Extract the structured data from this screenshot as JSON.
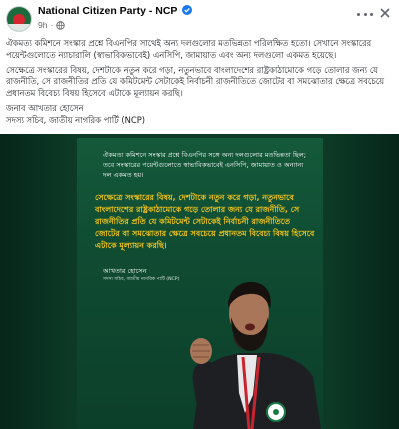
{
  "post": {
    "page_name": "National Citizen Party - NCP",
    "verified": true,
    "time": "9h",
    "separator": "·",
    "paragraphs": [
      "ঐকমত্য কমিশনে সংস্কার প্রশ্নে বিএনপির সাথেই অন্য দলগুলোর মতভিন্নতা পরিলক্ষিত হতো। সেখানে সংস্কারের পয়েন্টগুলোতে ন্যাচারালি (স্বাভাবিকভাবেই) এনসিপি, জামায়াত এবং অন্য দলগুলো একমত হয়েছে।",
      "সেক্ষেত্রে সংস্কারের বিষয়, দেশটাকে নতুন করে গড়া, নতুনভাবে বাংলাদেশের রাষ্ট্রকাঠামোকে গড়ে তোলার জন্য যে রাজনীতি, সে রাজনীতির প্রতি যে কমিটমেন্ট সেটাকেই নির্বাচনী রাজনীতিতে জোটের বা সমঝোতার ক্ষেত্রে সবচেয়ে প্রধানতম বিবেচ্য বিষয় হিসেবে এটাকে মূল্যায়ন করছি।"
    ],
    "author_name": "জনাব আখতার হোসেন",
    "author_role": "সদস্য সচিব, জাতীয় নাগরিক পার্টি (NCP)"
  },
  "poster": {
    "top_text": "ঐকমত্য কমিশনে সংস্কার প্রশ্নে বিএনপির সঙ্গে অন্য দলগুলোর মতভিন্নতা ছিল; তবে সংস্কারের পয়েন্টগুলোতে স্বাভাবিকভাবেই এনসিপি, জামায়াত ও অন্যান্য দল একমত হয়।",
    "highlight_text": "সেক্ষেত্রে সংস্কারের বিষয়, দেশটাকে নতুন করে গড়া, নতুনভাবে বাংলাদেশের রাষ্ট্রকাঠামোকে গড়ে তোলার জন্য যে রাজনীতি, সে রাজনীতির প্রতি যে কমিটমেন্ট সেটাকেই নির্বাচনী রাজনীতিতে জোটের বা সমঝোতার ক্ষেত্রে সবচেয়ে প্রধানতম বিবেচ্য বিষয় হিসেবে এটাকে মূল্যায়ন করছি।",
    "speaker_name": "আখতার হোসেন",
    "speaker_role": "সদস্য সচিব, জাতীয় নাগরিক পার্টি (NCP)"
  },
  "icons": {
    "globe": "globe-icon",
    "more": "more-options-icon",
    "close": "close-icon",
    "verified": "verified-badge-icon"
  },
  "colors": {
    "poster_green": "#14593a",
    "highlight_yellow": "#f5c518",
    "verified_blue": "#1877f2",
    "ncp_red": "#d72630"
  }
}
